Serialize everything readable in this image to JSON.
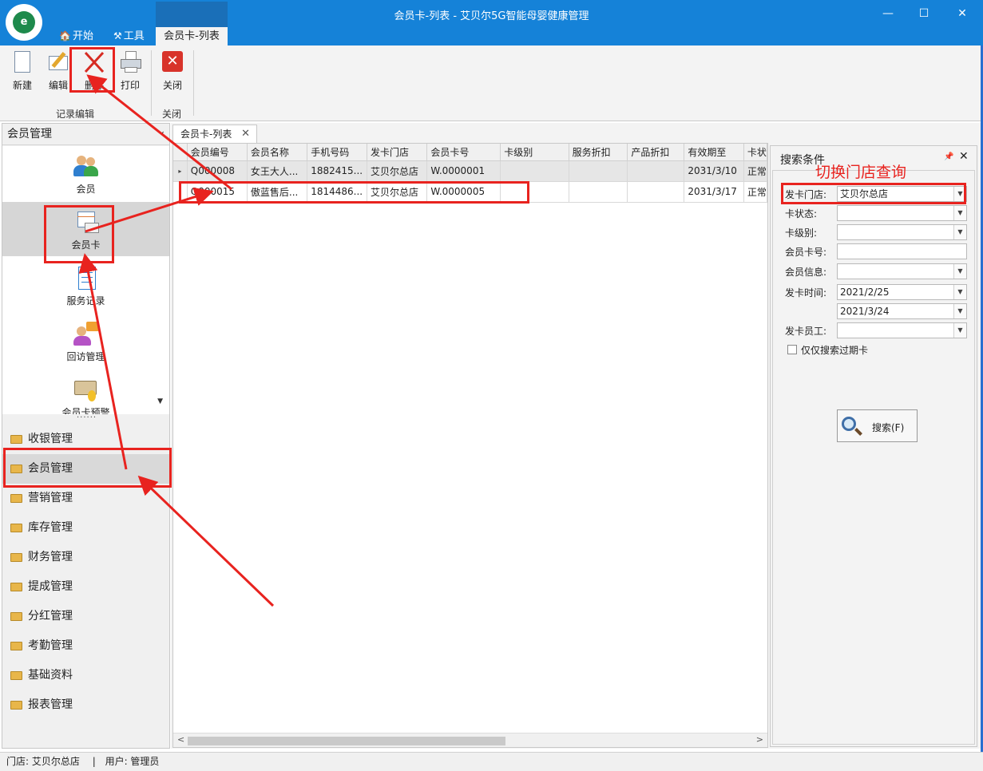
{
  "window": {
    "title": "会员卡-列表 - 艾贝尔5G智能母婴健康管理",
    "logo_text": "e",
    "controls": {
      "minimize": "—",
      "maximize": "☐",
      "close": "✕"
    }
  },
  "ribbon_tabs": [
    {
      "label": "开始",
      "icon": "home-icon"
    },
    {
      "label": "工具",
      "icon": "tools-icon"
    },
    {
      "label": "会员卡-列表",
      "active": true
    }
  ],
  "ribbon": {
    "buttons": [
      {
        "label": "新建",
        "icon": "new-document-icon"
      },
      {
        "label": "编辑",
        "icon": "edit-pencil-icon"
      },
      {
        "label": "删除",
        "icon": "delete-x-icon"
      },
      {
        "label": "打印",
        "icon": "printer-icon"
      },
      {
        "label": "关闭",
        "icon": "close-red-icon"
      }
    ],
    "groups": [
      {
        "label": "记录编辑"
      },
      {
        "label": "关闭"
      }
    ]
  },
  "left_panel": {
    "header": "会员管理",
    "collapse_glyph": "‹",
    "scroll_glyph": "▼",
    "dots": "......",
    "nav_items": [
      {
        "label": "会员",
        "icon": "members-icon"
      },
      {
        "label": "会员卡",
        "icon": "member-card-icon",
        "selected": true
      },
      {
        "label": "服务记录",
        "icon": "service-record-icon"
      },
      {
        "label": "回访管理",
        "icon": "follow-up-icon"
      },
      {
        "label": "会员卡预警",
        "icon": "card-warning-icon"
      }
    ],
    "groups": [
      {
        "label": "收银管理"
      },
      {
        "label": "会员管理",
        "selected": true
      },
      {
        "label": "营销管理"
      },
      {
        "label": "库存管理"
      },
      {
        "label": "财务管理"
      },
      {
        "label": "提成管理"
      },
      {
        "label": "分红管理"
      },
      {
        "label": "考勤管理"
      },
      {
        "label": "基础资料"
      },
      {
        "label": "报表管理"
      }
    ]
  },
  "doc_tab": {
    "label": "会员卡-列表",
    "close": "✕"
  },
  "grid": {
    "columns": [
      "会员编号",
      "会员名称",
      "手机号码",
      "发卡门店",
      "会员卡号",
      "卡级别",
      "服务折扣",
      "产品折扣",
      "有效期至",
      "卡状"
    ],
    "rows": [
      [
        "Q000008",
        "女王大人...",
        "1882415...",
        "艾贝尔总店",
        "W.0000001",
        "",
        "",
        "",
        "2031/3/10",
        "正常"
      ],
      [
        "Q000015",
        "傲蓝售后...",
        "1814486...",
        "艾贝尔总店",
        "W.0000005",
        "",
        "",
        "",
        "2031/3/17",
        "正常"
      ]
    ],
    "row_indicator": "▸",
    "scroll_left": "<",
    "scroll_right": ">"
  },
  "search_panel": {
    "title": "搜索条件",
    "pin_glyph": "📌",
    "close_glyph": "✕",
    "fields": [
      {
        "label": "发卡门店:",
        "value": "艾贝尔总店",
        "dropdown": true
      },
      {
        "label": "卡状态:",
        "value": "",
        "dropdown": true
      },
      {
        "label": "卡级别:",
        "value": "",
        "dropdown": true
      },
      {
        "label": "会员卡号:",
        "value": "",
        "dropdown": false
      },
      {
        "label": "会员信息:",
        "value": "",
        "dropdown": true
      },
      {
        "label": "发卡时间:",
        "value": "2021/2/25",
        "dropdown": true
      },
      {
        "label": "",
        "value": "2021/3/24",
        "dropdown": true
      },
      {
        "label": "发卡员工:",
        "value": "",
        "dropdown": true
      }
    ],
    "dropdown_glyph": "▼",
    "checkbox_label": "仅仅搜索过期卡",
    "search_button": "搜索(F)"
  },
  "annotation": {
    "text": "切换门店查询",
    "color": "#e8231f"
  },
  "status_bar": {
    "store": "门店: 艾贝尔总店",
    "separator": "|",
    "user": "用户: 管理员"
  },
  "colors": {
    "titlebar": "#1582d8",
    "ribbon": "#f3f3f3",
    "selected": "#d6d6d6"
  }
}
